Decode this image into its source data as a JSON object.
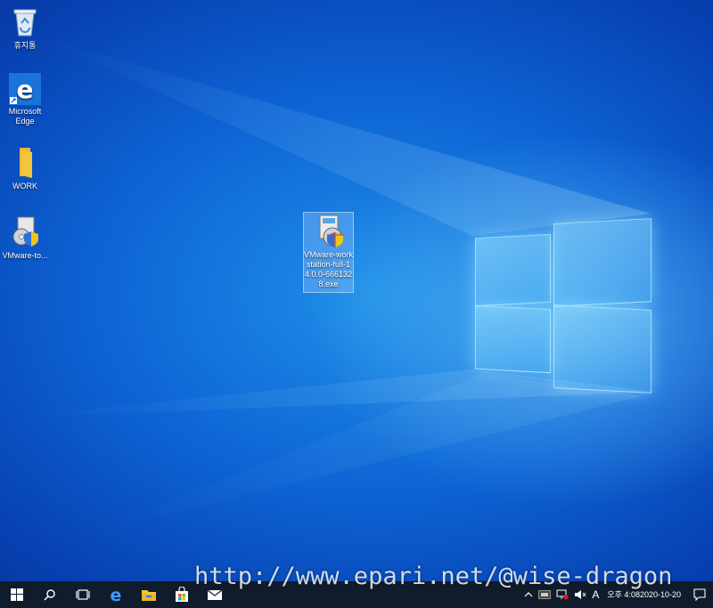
{
  "desktop": {
    "icons": [
      {
        "label": "휴지통"
      },
      {
        "label": "Microsoft Edge"
      },
      {
        "label": "WORK"
      },
      {
        "label": "VMware-to..."
      },
      {
        "label": "VMware-workstation-full-14.0.0-6661328.exe"
      }
    ]
  },
  "taskbar": {
    "tray": {
      "ime": "A",
      "time": "오후 4:08",
      "date": "2020-10-20"
    }
  },
  "watermark": "http://www.epari.net/@wise-dragon",
  "colors": {
    "taskbar": "#101c2c",
    "desktop_accent": "#0d63d4",
    "edge_blue": "#1a73d9",
    "folder_yellow": "#f3c53c"
  }
}
